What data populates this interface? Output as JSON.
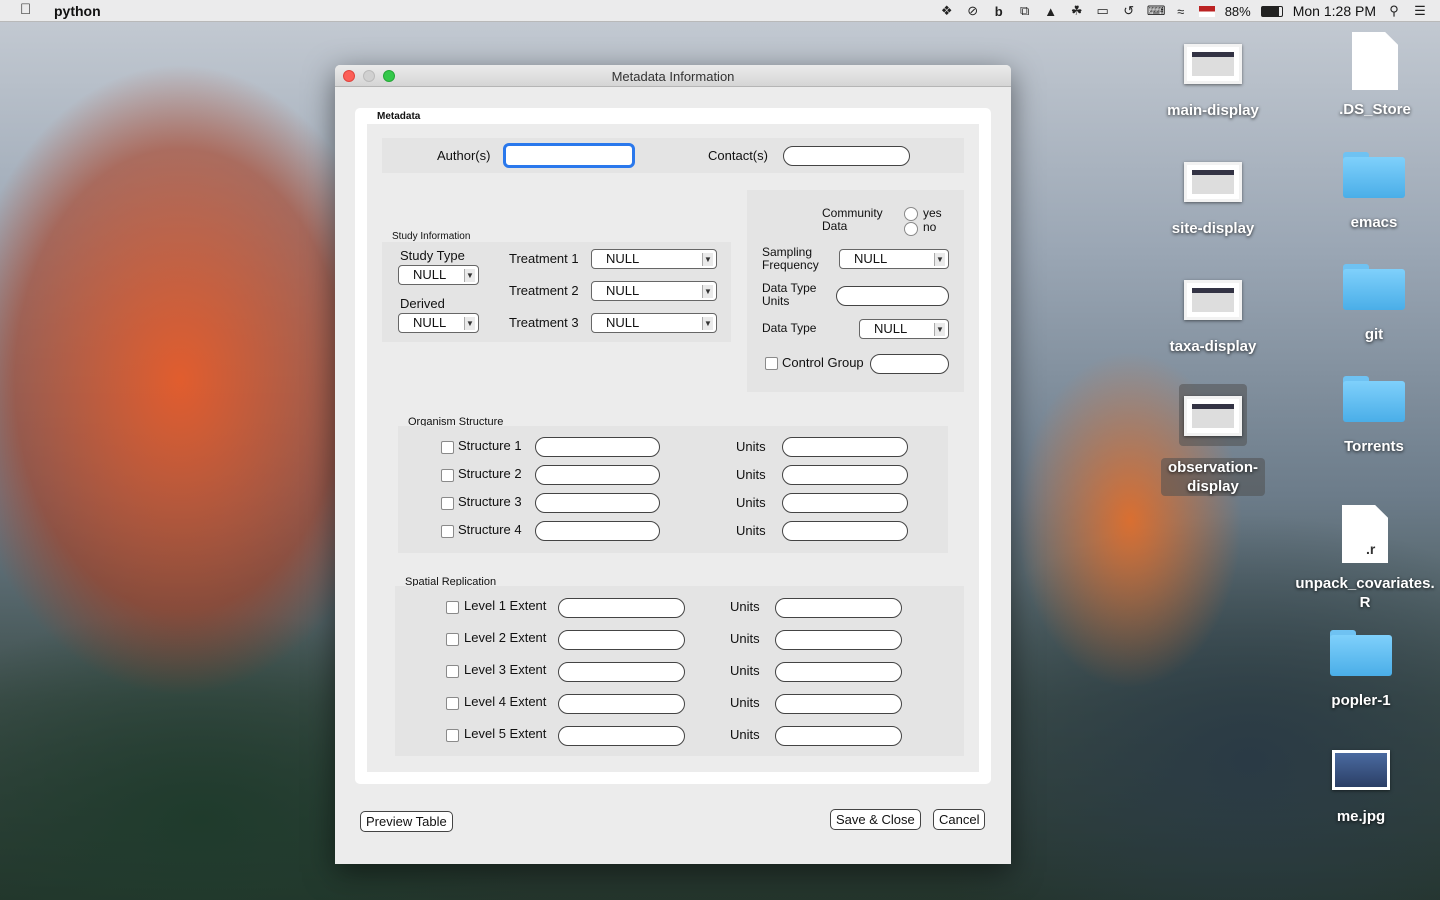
{
  "menubar": {
    "app_name": "python",
    "battery": "88%",
    "clock": "Mon 1:28 PM"
  },
  "desktop_icons": [
    {
      "label": "main-display"
    },
    {
      "label": ".DS_Store"
    },
    {
      "label": "site-display"
    },
    {
      "label": "emacs"
    },
    {
      "label": "taxa-display"
    },
    {
      "label": "git"
    },
    {
      "label": "observation-display"
    },
    {
      "label": "Torrents"
    },
    {
      "label": "unpack_covariates.R",
      "badge": ".r"
    },
    {
      "label": "popler-1"
    },
    {
      "label": "me.jpg"
    }
  ],
  "window": {
    "title": "Metadata Information",
    "metadata_group": "Metadata",
    "author_label": "Author(s)",
    "author_value": "",
    "contact_label": "Contact(s)",
    "contact_value": "",
    "study": {
      "group": "Study Information",
      "study_type_label": "Study Type",
      "study_type_value": "NULL",
      "derived_label": "Derived",
      "derived_value": "NULL",
      "treatment1_label": "Treatment 1",
      "treatment1_value": "NULL",
      "treatment2_label": "Treatment 2",
      "treatment2_value": "NULL",
      "treatment3_label": "Treatment 3",
      "treatment3_value": "NULL"
    },
    "community": {
      "community_label_1": "Community",
      "community_label_2": "Data",
      "yes_label": "yes",
      "no_label": "no",
      "sampling_label_1": "Sampling",
      "sampling_label_2": "Frequency",
      "sampling_value": "NULL",
      "data_type_units_label_1": "Data Type",
      "data_type_units_label_2": "Units",
      "data_type_label": "Data Type",
      "data_type_value": "NULL",
      "control_group_label": "Control Group"
    },
    "organism": {
      "group": "Organism Structure",
      "units_label": "Units",
      "rows": [
        "Structure 1",
        "Structure 2",
        "Structure 3",
        "Structure 4"
      ]
    },
    "spatial": {
      "group": "Spatial Replication",
      "units_label": "Units",
      "rows": [
        "Level 1 Extent",
        "Level 2 Extent",
        "Level 3 Extent",
        "Level 4 Extent",
        "Level 5 Extent"
      ]
    },
    "buttons": {
      "preview": "Preview Table",
      "save": "Save & Close",
      "cancel": "Cancel"
    }
  }
}
